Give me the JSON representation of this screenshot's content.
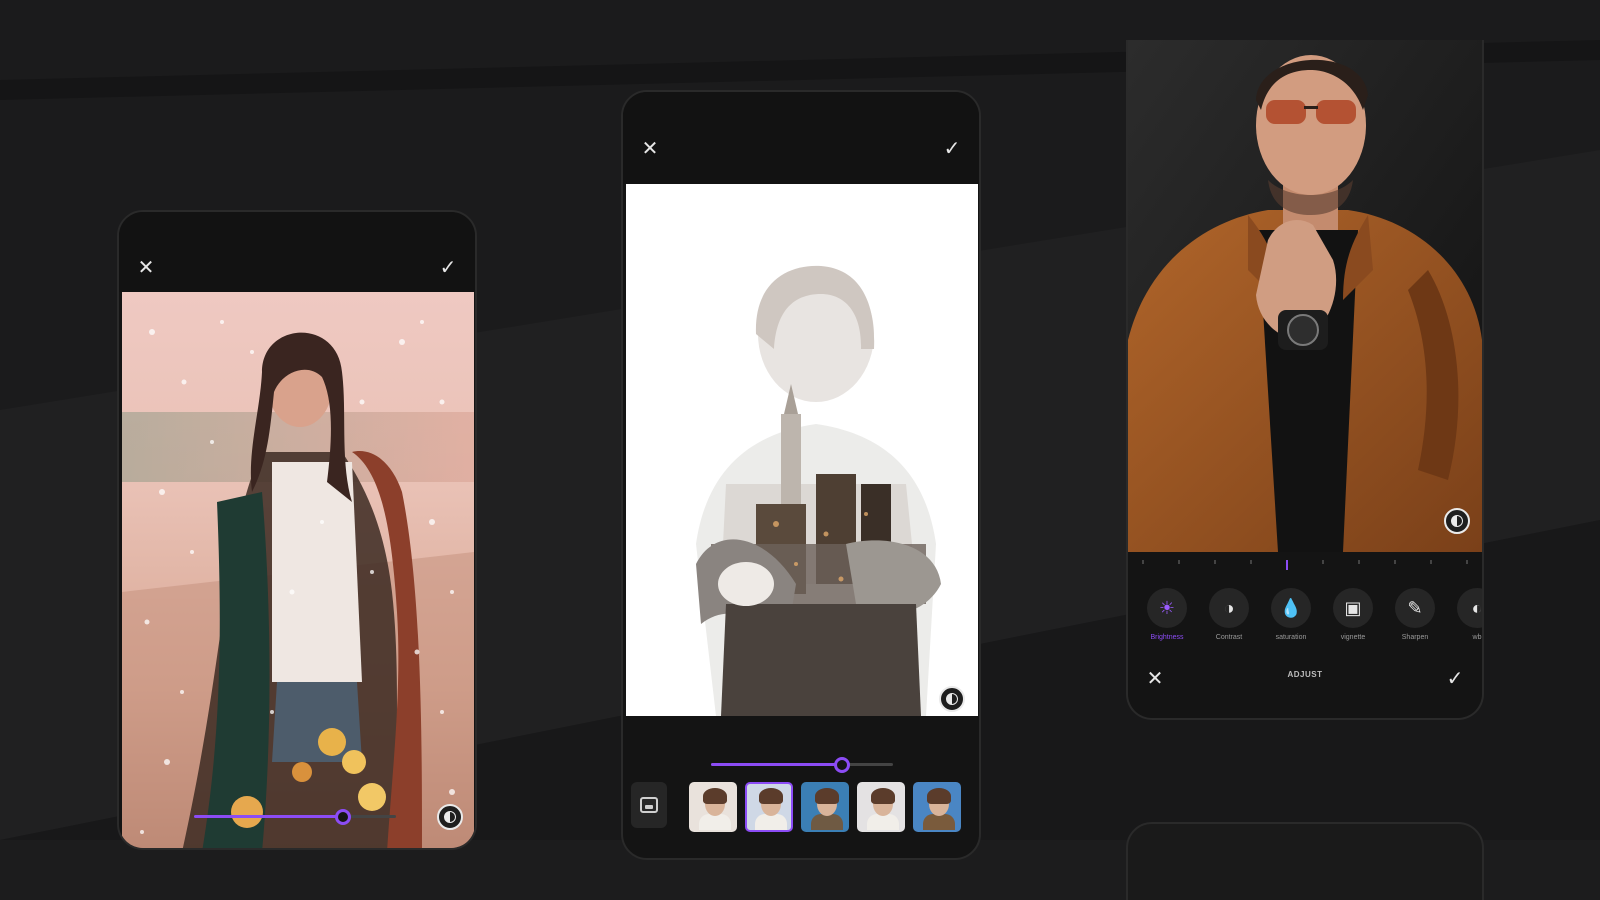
{
  "theme": {
    "background": "#1b1b1c",
    "accent": "#8c4cf5",
    "panel": "#141414"
  },
  "screen1": {
    "close_icon": "✕",
    "confirm_icon": "✓",
    "slider_value": 0.74,
    "compare_icon": "compare-icon"
  },
  "screen2": {
    "close_icon": "✕",
    "confirm_icon": "✓",
    "slider_value": 0.72,
    "compare_icon": "compare-icon",
    "gallery_icon": "image-icon",
    "thumbnails": [
      {
        "label": "",
        "selected": false,
        "bg": "#e9e2dc"
      },
      {
        "label": "",
        "selected": true,
        "bg": "#cfd8e6"
      },
      {
        "label": "",
        "selected": false,
        "bg": "#3b7fb5"
      },
      {
        "label": "",
        "selected": false,
        "bg": "#e4e2e3"
      },
      {
        "label": "",
        "selected": false,
        "bg": "#4a86c4"
      }
    ]
  },
  "screen3": {
    "compare_icon": "compare-icon",
    "tools": [
      {
        "icon": "☀",
        "label": "Brightness",
        "active": true
      },
      {
        "icon": "◑",
        "label": "Contrast",
        "active": false
      },
      {
        "icon": "💧",
        "label": "saturation",
        "active": false
      },
      {
        "icon": "▣",
        "label": "vignette",
        "active": false
      },
      {
        "icon": "✎",
        "label": "Sharpen",
        "active": false
      },
      {
        "icon": "◐",
        "label": "wb",
        "active": false
      }
    ],
    "cancel_icon": "✕",
    "title": "ADJUST",
    "confirm_icon": "✓"
  }
}
